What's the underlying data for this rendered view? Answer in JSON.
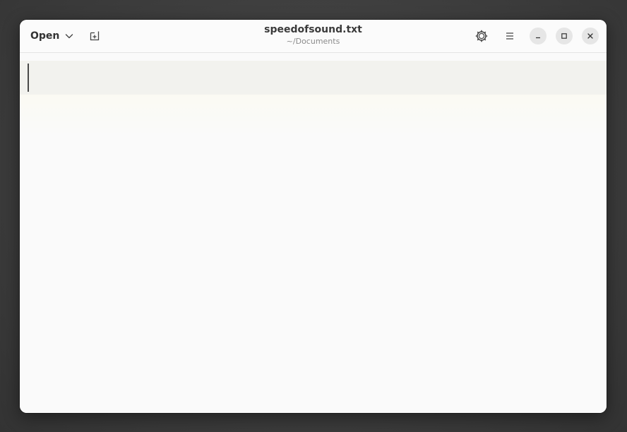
{
  "window": {
    "title": "speedofsound.txt",
    "subtitle": "~/Documents"
  },
  "headerbar": {
    "open_label": "Open",
    "open_icon": "chevron-down-icon",
    "new_tab_icon": "new-tab-icon",
    "spell_icon": "gear-icon",
    "menu_icon": "hamburger-menu-icon",
    "minimize_icon": "minimize-icon",
    "maximize_icon": "maximize-icon",
    "close_icon": "close-icon"
  },
  "editor": {
    "content": ""
  },
  "colors": {
    "window_bg": "#fafafa",
    "current_line": "#f2f2ee",
    "desktop_bg": "#3a3a3a"
  }
}
